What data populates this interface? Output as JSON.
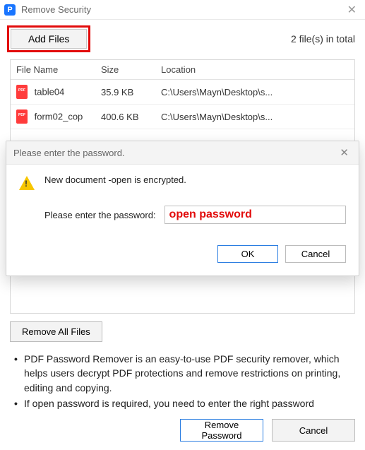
{
  "window": {
    "title": "Remove Security"
  },
  "toolbar": {
    "add_files_label": "Add Files",
    "total_label": "2 file(s) in total"
  },
  "table": {
    "headers": {
      "name": "File Name",
      "size": "Size",
      "location": "Location"
    },
    "rows": [
      {
        "name": "table04",
        "size": "35.9 KB",
        "location": "C:\\Users\\Mayn\\Desktop\\s..."
      },
      {
        "name": "form02_cop",
        "size": "400.6 KB",
        "location": "C:\\Users\\Mayn\\Desktop\\s..."
      }
    ]
  },
  "modal": {
    "title": "Please enter the password.",
    "message": "New document -open is encrypted.",
    "prompt": "Please enter the password:",
    "password_placeholder": "open password",
    "ok_label": "OK",
    "cancel_label": "Cancel"
  },
  "actions": {
    "remove_all_label": "Remove All Files"
  },
  "info": {
    "bullets": [
      "PDF Password Remover is an easy-to-use PDF security remover, which helps users decrypt PDF protections and remove restrictions on printing, editing and copying.",
      "If open password is required, you need to enter the right password"
    ]
  },
  "footer": {
    "remove_label": "Remove Password",
    "cancel_label": "Cancel"
  }
}
